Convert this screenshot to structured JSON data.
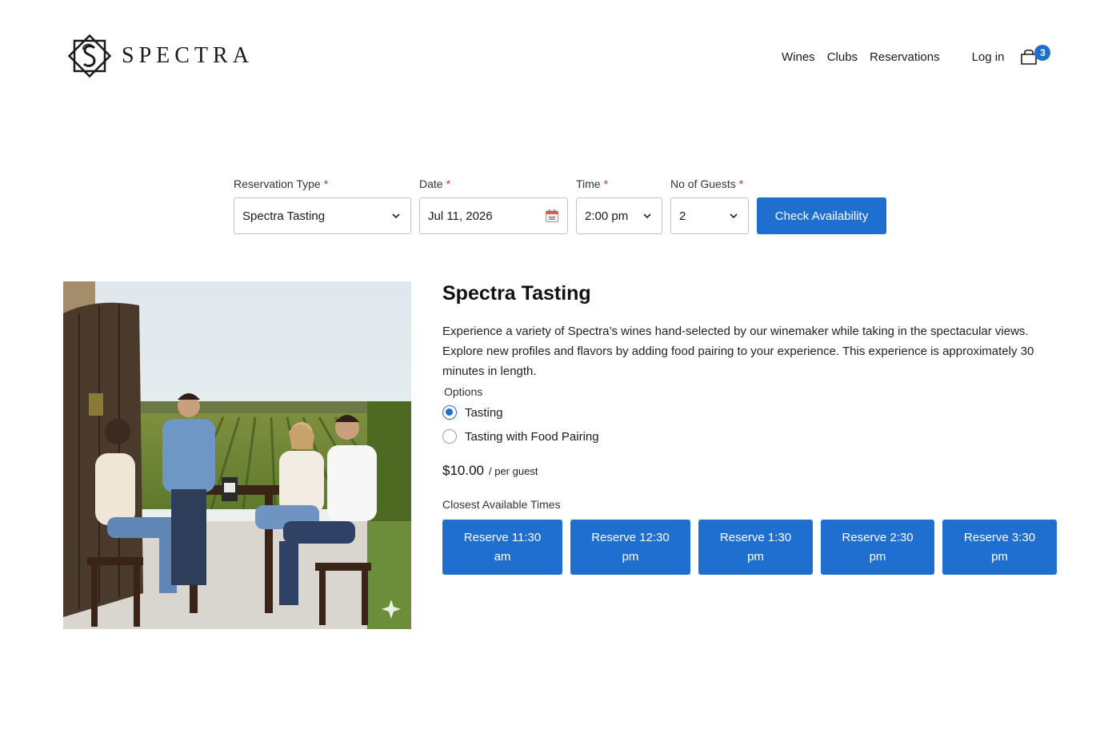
{
  "brand": {
    "name": "SPECTRA"
  },
  "nav": {
    "items": [
      {
        "label": "Wines"
      },
      {
        "label": "Clubs"
      },
      {
        "label": "Reservations"
      }
    ],
    "login": "Log in",
    "cart_count": "3"
  },
  "form": {
    "type_label": "Reservation Type",
    "type_value": "Spectra Tasting",
    "date_label": "Date",
    "date_value": "Jul 11, 2026",
    "time_label": "Time",
    "time_value": "2:00 pm",
    "guests_label": "No of Guests",
    "guests_value": "2",
    "required_mark": "*",
    "submit": "Check Availability"
  },
  "experience": {
    "title": "Spectra Tasting",
    "description": "Experience a variety of Spectra’s wines hand-selected by our winemaker while taking in the spectacular views. Explore new profiles and flavors by adding food pairing to your experience. This experience is approximately 30 minutes in length.",
    "options_label": "Options",
    "options": [
      {
        "label": "Tasting",
        "selected": true
      },
      {
        "label": "Tasting with Food Pairing",
        "selected": false
      }
    ],
    "price": "$10.00",
    "price_unit": "/ per guest",
    "closest_label": "Closest Available Times",
    "times": [
      {
        "line1": "Reserve 11:30",
        "line2": "am"
      },
      {
        "line1": "Reserve 12:30",
        "line2": "pm"
      },
      {
        "line1": "Reserve 1:30",
        "line2": "pm"
      },
      {
        "line1": "Reserve 2:30",
        "line2": "pm"
      },
      {
        "line1": "Reserve 3:30",
        "line2": "pm"
      }
    ]
  },
  "colors": {
    "accent": "#1f6fd1",
    "required": "#d32f2f"
  },
  "icons": [
    "spectra-logo-icon",
    "cart-icon",
    "chevron-down-icon",
    "calendar-icon",
    "sparkle-icon"
  ]
}
